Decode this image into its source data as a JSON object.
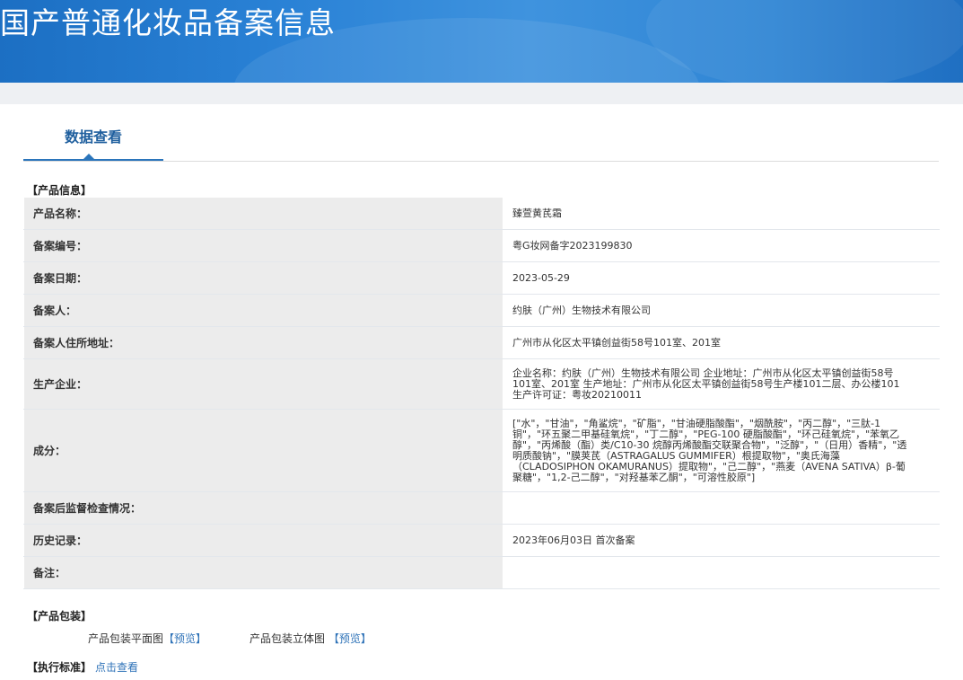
{
  "header": {
    "title": "国产普通化妆品备案信息"
  },
  "tabs": [
    {
      "label": "数据查看"
    }
  ],
  "product_info": {
    "section_title": "【产品信息】",
    "rows": [
      {
        "key": "产品名称：",
        "value": "臻萱黄芪霜"
      },
      {
        "key": "备案编号：",
        "value": "粤G妆网备字2023199830"
      },
      {
        "key": "备案日期：",
        "value": "2023-05-29"
      },
      {
        "key": "备案人：",
        "value": "约肤（广州）生物技术有限公司"
      },
      {
        "key": "备案人住所地址：",
        "value": "广州市从化区太平镇创益街58号101室、201室"
      },
      {
        "key": "生产企业：",
        "value": "企业名称：约肤（广州）生物技术有限公司 企业地址：广州市从化区太平镇创益街58号101室、201室 生产地址：广州市从化区太平镇创益街58号生产楼101二层、办公楼101 生产许可证：粤妆20210011"
      },
      {
        "key": "成分：",
        "value": "[\"水\"，\"甘油\"，\"角鲨烷\"，\"矿脂\"，\"甘油硬脂酸酯\"，\"烟酰胺\"，\"丙二醇\"，\"三肽-1铜\"，\"环五聚二甲基硅氧烷\"，\"丁二醇\"，\"PEG-100 硬脂酸酯\"，\"环己硅氧烷\"，\"苯氧乙醇\"，\"丙烯酸（酯）类/C10-30 烷醇丙烯酸酯交联聚合物\"，\"泛醇\"，\"（日用）香精\"，\"透明质酸钠\"，\"膜荚芪（ASTRAGALUS GUMMIFER）根提取物\"，\"奥氏海藻（CLADOSIPHON OKAMURANUS）提取物\"，\"己二醇\"，\"燕麦（AVENA SATIVA）β-葡聚糖\"，\"1,2-己二醇\"，\"对羟基苯乙酮\"，\"可溶性胶原\"]"
      },
      {
        "key": "备案后监督检查情况：",
        "value": ""
      },
      {
        "key": "历史记录：",
        "value": "2023年06月03日 首次备案"
      },
      {
        "key": "备注：",
        "value": ""
      }
    ]
  },
  "packaging": {
    "section_title": "【产品包装】",
    "flat_label": "产品包装平面图",
    "flat_link": "【预览】",
    "solid_label": "产品包装立体图",
    "solid_link": "【预览】"
  },
  "standard": {
    "section_title": "【执行标准】",
    "link": "点击查看"
  },
  "colors": {
    "banner": "#2a82d6",
    "accent": "#2b75bb",
    "link": "#2f73b8",
    "key_bg": "#ececec"
  }
}
